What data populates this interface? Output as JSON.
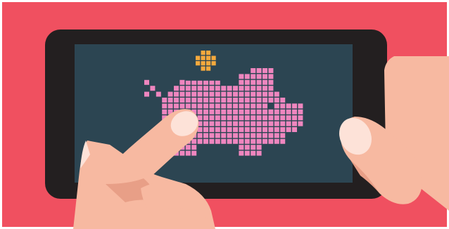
{
  "scene": {
    "background_color": "#f05060",
    "phone_body_color": "#231f20",
    "screen_color": "#2c4552",
    "skin_color": "#f7b9a1",
    "skin_shadow_color": "#e89f87",
    "nail_color": "#fde2d8",
    "pixel_pig_color": "#ef86bf",
    "pixel_coin_color": "#f5a93d"
  },
  "icons": [
    "piggy-bank-icon",
    "coin-icon",
    "phone",
    "left-hand",
    "right-hand"
  ]
}
